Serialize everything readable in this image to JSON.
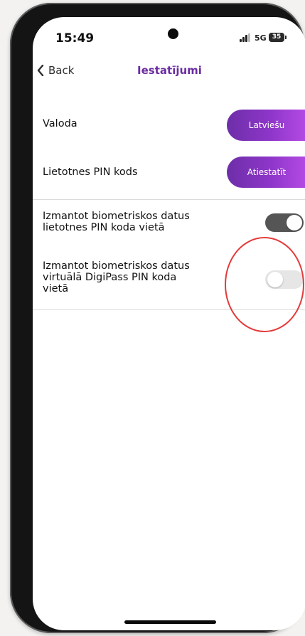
{
  "status_bar": {
    "time": "15:49",
    "network": "5G",
    "battery": "35"
  },
  "nav": {
    "back_label": "Back",
    "title": "Iestatījumi"
  },
  "settings": {
    "language": {
      "label": "Valoda",
      "button": "Latviešu"
    },
    "pin": {
      "label": "Lietotnes PIN kods",
      "button": "Atiestatīt"
    },
    "biometric_app_pin": {
      "label_line1": "Izmantot biometriskos datus",
      "label_line2": "lietotnes PIN koda vietā",
      "enabled": true
    },
    "biometric_digipass": {
      "label_line1": "Izmantot biometriskos datus",
      "label_line2": "virtuālā DigiPass PIN koda",
      "label_line3": "vietā",
      "enabled": false
    }
  },
  "colors": {
    "accent": "#6b2da0",
    "button_gradient_start": "#6d2ea8",
    "button_gradient_end": "#b44ae4",
    "toggle_on": "#555555",
    "toggle_off": "#e6e6e6",
    "highlight": "#e53a3a"
  },
  "icons": {
    "back": "chevron-left-icon",
    "signal": "signal-bars-icon",
    "battery": "battery-icon"
  }
}
